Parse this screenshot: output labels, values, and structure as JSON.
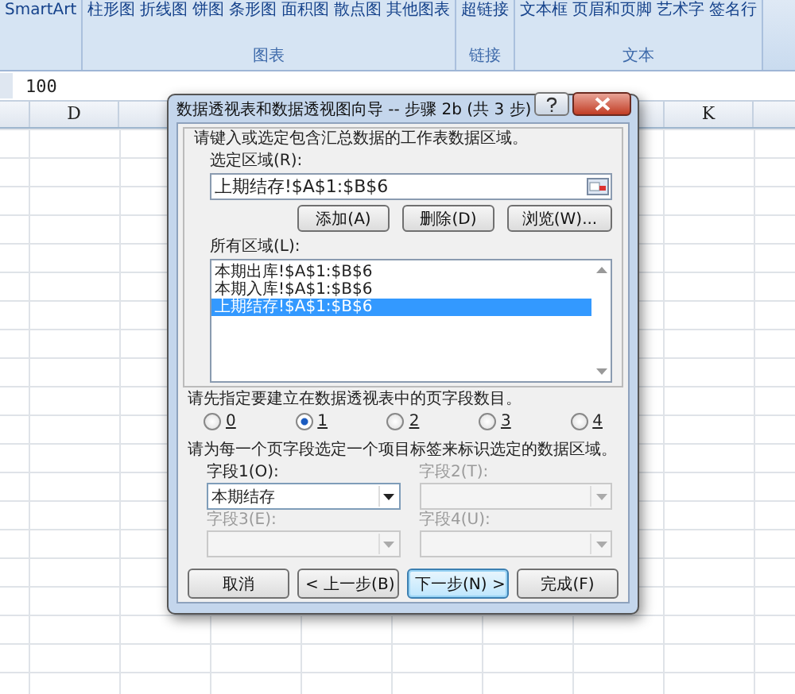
{
  "ribbon": {
    "groups": [
      {
        "buttons": [
          "SmartArt"
        ]
      },
      {
        "label": "图表",
        "buttons": [
          "柱形图",
          "折线图",
          "饼图",
          "条形图",
          "面积图",
          "散点图",
          "其他图表"
        ]
      },
      {
        "label": "链接",
        "buttons": [
          "超链接"
        ]
      },
      {
        "label": "文本",
        "buttons": [
          "文本框",
          "页眉和页脚",
          "艺术字",
          "签名行"
        ]
      }
    ]
  },
  "formula_bar": {
    "value": "100"
  },
  "sheet": {
    "columns": [
      {
        "label": "D"
      },
      {
        "label": "K"
      }
    ]
  },
  "dialog": {
    "title": "数据透视表和数据透视图向导 -- 步骤 2b (共 3 步)",
    "instruction": "请键入或选定包含汇总数据的工作表数据区域。",
    "range_label": "选定区域(R):",
    "range_value": "上期结存!$A$1:$B$6",
    "range_buttons": [
      "添加(A)",
      "删除(D)",
      "浏览(W)..."
    ],
    "list_label": "所有区域(L):",
    "list_items": [
      {
        "text": "本期出库!$A$1:$B$6",
        "selected": false
      },
      {
        "text": "本期入库!$A$1:$B$6",
        "selected": false
      },
      {
        "text": "上期结存!$A$1:$B$6",
        "selected": true
      }
    ],
    "page_prompt": "请先指定要建立在数据透视表中的页字段数目。",
    "page_options": [
      {
        "label": "0",
        "selected": false
      },
      {
        "label": "1",
        "selected": true
      },
      {
        "label": "2",
        "selected": false
      },
      {
        "label": "3",
        "selected": false
      },
      {
        "label": "4",
        "selected": false
      }
    ],
    "field_prompt": "请为每一个页字段选定一个项目标签来标识选定的数据区域。",
    "fields": [
      {
        "label": "字段1(O):",
        "value": "本期结存",
        "disabled": false
      },
      {
        "label": "字段2(T):",
        "disabled": true
      },
      {
        "label": "字段3(E):",
        "disabled": true
      },
      {
        "label": "字段4(U):",
        "disabled": true
      }
    ],
    "buttons": [
      {
        "label": "取消",
        "default": false
      },
      {
        "label": "< 上一步(B)",
        "default": false
      },
      {
        "label": "下一步(N) >",
        "default": true
      },
      {
        "label": "完成(F)",
        "default": false
      }
    ]
  }
}
